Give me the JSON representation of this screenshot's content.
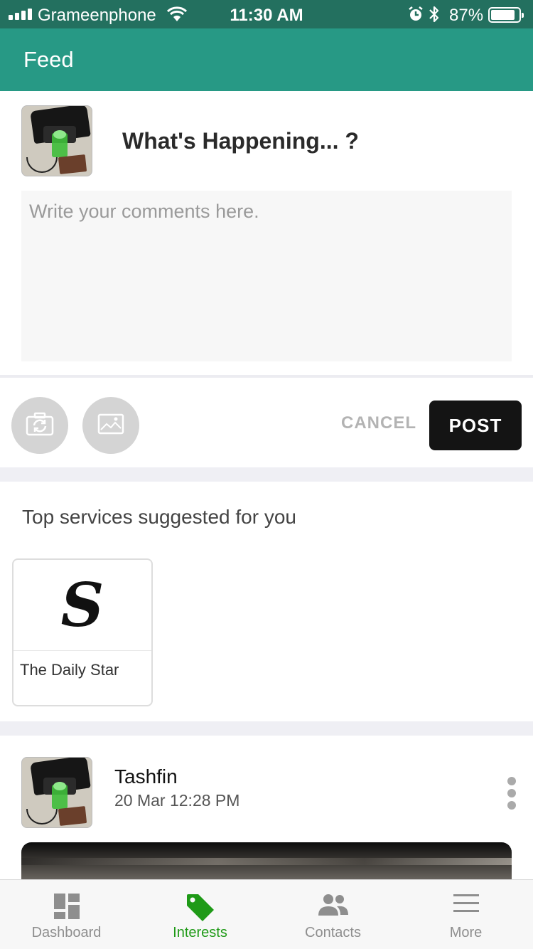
{
  "status_bar": {
    "carrier": "Grameenphone",
    "time": "11:30 AM",
    "battery_percent": "87%",
    "battery_level": 0.87,
    "icons": [
      "signal-icon",
      "wifi-icon",
      "alarm-icon",
      "bluetooth-icon",
      "battery-icon"
    ]
  },
  "header": {
    "title": "Feed"
  },
  "composer": {
    "prompt": "What's Happening... ?",
    "comment_placeholder": "Write your comments here.",
    "comment_value": "",
    "cancel_label": "CANCEL",
    "post_label": "POST",
    "icons": [
      "camera-switch-icon",
      "image-icon"
    ]
  },
  "suggestions": {
    "heading": "Top services suggested for you",
    "services": [
      {
        "name": "The Daily Star",
        "logo_letter": "S"
      }
    ]
  },
  "post": {
    "author": "Tashfin",
    "date": "20 Mar 12:28 PM"
  },
  "tabbar": {
    "tabs": [
      {
        "label": "Dashboard",
        "icon": "dashboard-icon",
        "active": false
      },
      {
        "label": "Interests",
        "icon": "tag-icon",
        "active": true
      },
      {
        "label": "Contacts",
        "icon": "contacts-icon",
        "active": false
      },
      {
        "label": "More",
        "icon": "menu-icon",
        "active": false
      }
    ]
  },
  "colors": {
    "status_bar": "#23705f",
    "header": "#279985",
    "active_tab": "#1f9a17",
    "inactive_tab": "#8e8e8e",
    "post_button": "#141414"
  }
}
